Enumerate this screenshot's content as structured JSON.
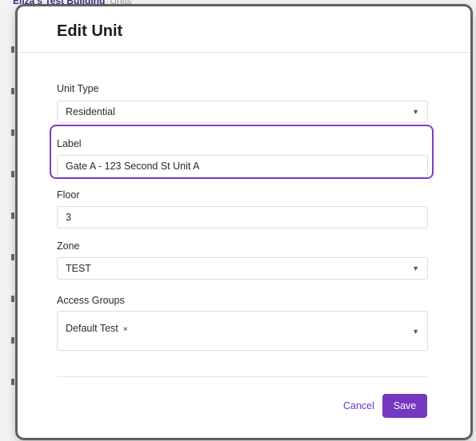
{
  "background": {
    "breadcrumb_building": "Eliza's Test Building",
    "breadcrumb_section": "Units"
  },
  "modal": {
    "title": "Edit Unit",
    "fields": {
      "unit_type": {
        "label": "Unit Type",
        "value": "Residential",
        "icon": "chevron-down-icon"
      },
      "label": {
        "label": "Label",
        "value": "Gate A - 123 Second St Unit A"
      },
      "floor": {
        "label": "Floor",
        "value": "3"
      },
      "zone": {
        "label": "Zone",
        "value": "TEST",
        "icon": "chevron-down-icon"
      },
      "access_groups": {
        "label": "Access Groups",
        "chips": [
          {
            "text": "Default Test",
            "remove": "×"
          }
        ],
        "icon": "chevron-down-icon"
      }
    },
    "actions": {
      "cancel_label": "Cancel",
      "save_label": "Save"
    }
  },
  "colors": {
    "accent": "#7438c1",
    "highlight": "#7b3fc4",
    "link": "#6a3bbf"
  }
}
